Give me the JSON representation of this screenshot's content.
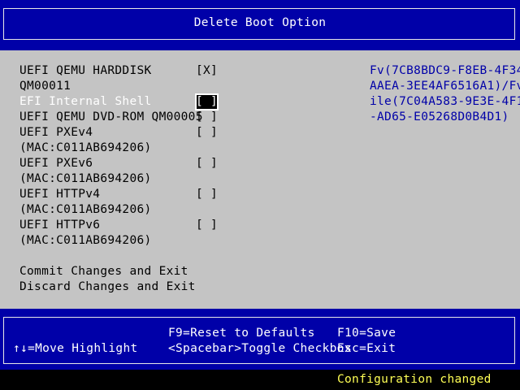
{
  "title": "Delete Boot Option",
  "options": [
    {
      "line1": "UEFI QEMU HARDDISK",
      "line2": "QM00011",
      "checkbox": "[X]",
      "highlighted": false
    },
    {
      "line1": "EFI Internal Shell",
      "line2": "",
      "checkbox": "[ ]",
      "highlighted": true
    },
    {
      "line1": "UEFI QEMU DVD-ROM QM00005",
      "line2": "",
      "checkbox": "[ ]",
      "highlighted": false
    },
    {
      "line1": "UEFI PXEv4",
      "line2": "(MAC:C011AB694206)",
      "checkbox": "[ ]",
      "highlighted": false
    },
    {
      "line1": "UEFI PXEv6",
      "line2": "(MAC:C011AB694206)",
      "checkbox": "[ ]",
      "highlighted": false
    },
    {
      "line1": "UEFI HTTPv4",
      "line2": "(MAC:C011AB694206)",
      "checkbox": "[ ]",
      "highlighted": false
    },
    {
      "line1": "UEFI HTTPv6",
      "line2": "(MAC:C011AB694206)",
      "checkbox": "[ ]",
      "highlighted": false
    }
  ],
  "actions": {
    "commit": "Commit Changes and Exit",
    "discard": "Discard Changes and Exit"
  },
  "help_lines": [
    "Fv(7CB8BDC9-F8EB-4F34-",
    "AAEA-3EE4AF6516A1)/FvF",
    "ile(7C04A583-9E3E-4F1C",
    "-AD65-E05268D0B4D1)"
  ],
  "footer": {
    "move_highlight": "↑↓=Move Highlight",
    "reset_defaults": "F9=Reset to Defaults",
    "save": "F10=Save",
    "toggle_checkbox": "<Spacebar>Toggle Checkbox",
    "exit": "Esc=Exit"
  },
  "status": "Configuration changed",
  "colors": {
    "title_background": "#0000a8",
    "panel_background": "#c4c4c4",
    "help_text": "#0000a8",
    "status_text": "#ffff55"
  }
}
